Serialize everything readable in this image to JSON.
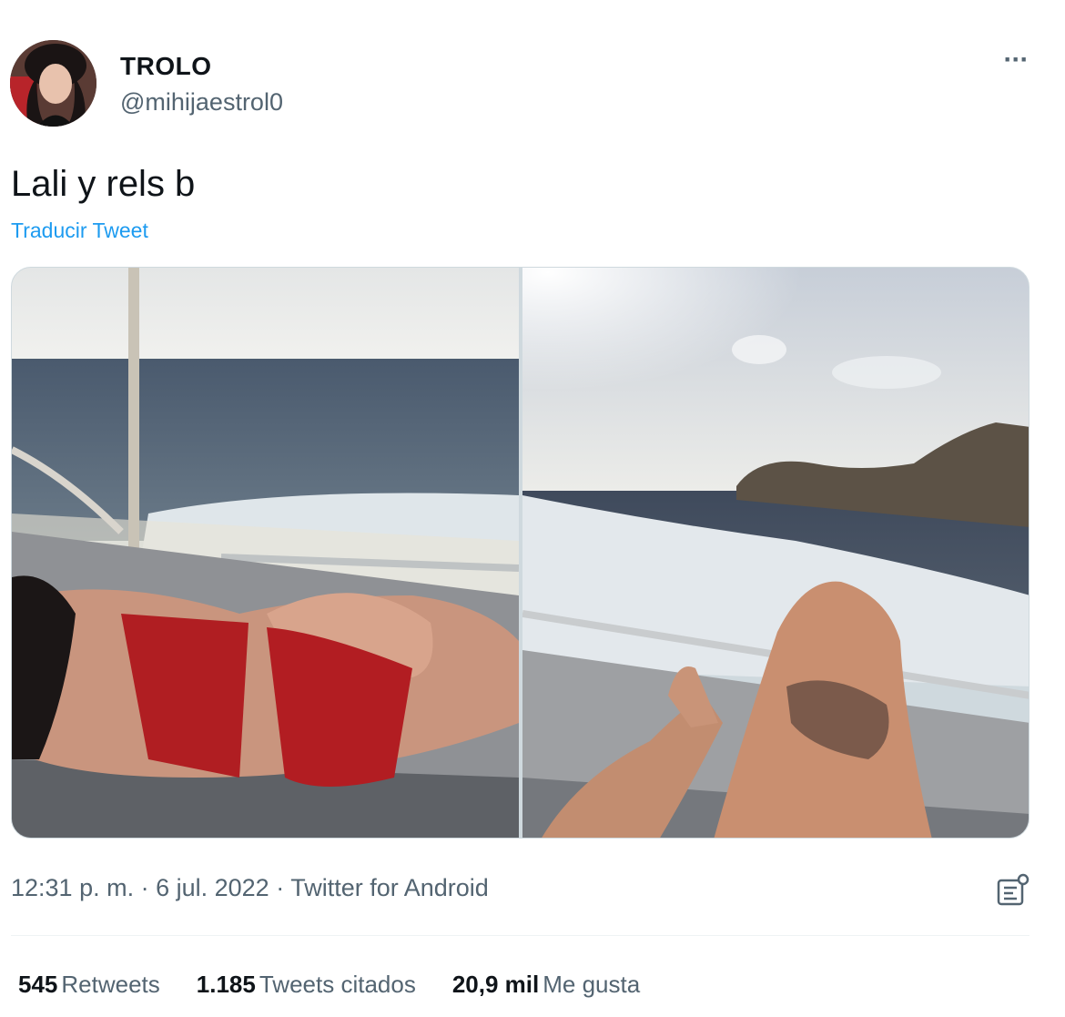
{
  "author": {
    "name": "TROLO",
    "handle": "@mihijaestrol0"
  },
  "tweet": {
    "text": "Lali y rels b",
    "translate_label": "Traducir Tweet"
  },
  "meta": {
    "time": "12:31 p. m.",
    "date": "6 jul. 2022",
    "source": "Twitter for Android",
    "separator": " · "
  },
  "stats": [
    {
      "count": "545",
      "label": "Retweets"
    },
    {
      "count": "1.185",
      "label": "Tweets citados"
    },
    {
      "count": "20,9 mil",
      "label": "Me gusta"
    }
  ],
  "icons": {
    "more": "more-options-icon",
    "analytics": "analytics-icon"
  },
  "colors": {
    "link": "#1d9bf0",
    "secondary_text": "#536471",
    "primary_text": "#0f1419"
  }
}
